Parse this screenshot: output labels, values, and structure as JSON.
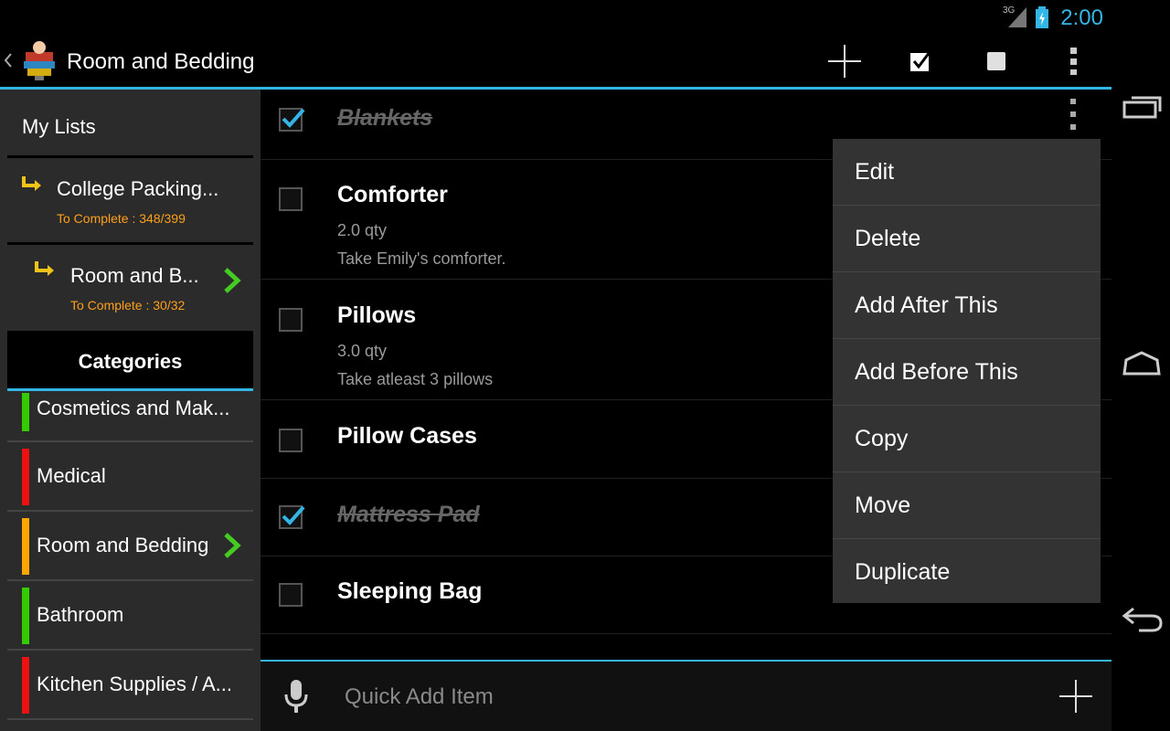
{
  "status_bar": {
    "time": "2:00",
    "network": "3G"
  },
  "action_bar": {
    "title": "Room and Bedding"
  },
  "sidebar": {
    "my_lists_label": "My Lists",
    "lists": [
      {
        "name": "College Packing...",
        "progress": "To Complete : 348/399"
      },
      {
        "name": "Room and B...",
        "progress": "To Complete : 30/32"
      }
    ],
    "categories_label": "Categories",
    "categories": [
      {
        "label": "Cosmetics and Mak...",
        "color": "#33cc00"
      },
      {
        "label": "Medical",
        "color": "#ee1111"
      },
      {
        "label": "Room and Bedding",
        "color": "#ffa500"
      },
      {
        "label": "Bathroom",
        "color": "#33cc00"
      },
      {
        "label": "Kitchen Supplies / A...",
        "color": "#ee1111"
      }
    ]
  },
  "items": [
    {
      "title": "Blankets",
      "checked": true
    },
    {
      "title": "Comforter",
      "qty": "2.0 qty",
      "note": "Take Emily's comforter.",
      "checked": false
    },
    {
      "title": "Pillows",
      "qty": "3.0 qty",
      "note": "Take atleast 3 pillows",
      "checked": false
    },
    {
      "title": "Pillow Cases",
      "checked": false
    },
    {
      "title": "Mattress Pad",
      "checked": true
    },
    {
      "title": "Sleeping Bag",
      "checked": false
    }
  ],
  "context_menu": [
    "Edit",
    "Delete",
    "Add After This",
    "Add Before This",
    "Copy",
    "Move",
    "Duplicate"
  ],
  "quick_add": {
    "placeholder": "Quick Add Item"
  },
  "colors": {
    "accent": "#33b5e5",
    "progress_text": "#ff9f1a",
    "active_chevron": "#44cc22"
  }
}
